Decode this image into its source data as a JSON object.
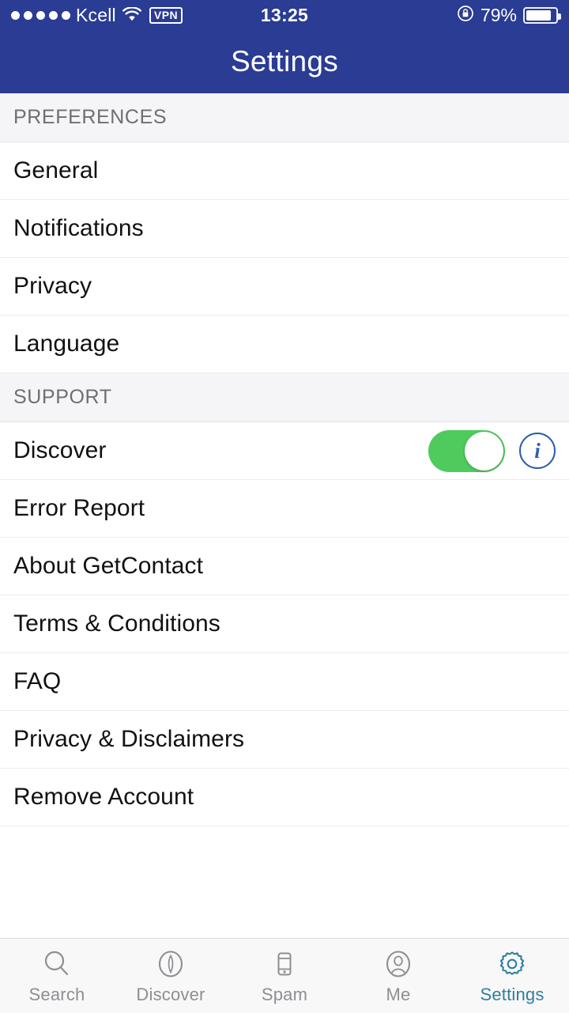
{
  "statusbar": {
    "signal_dots": 5,
    "carrier": "Kcell",
    "wifi_icon": "wifi-icon",
    "vpn_label": "VPN",
    "time": "13:25",
    "lock_icon": "rotation-lock-icon",
    "battery_pct": "79%",
    "battery_icon": "battery-icon"
  },
  "navbar": {
    "title": "Settings"
  },
  "sections": [
    {
      "header": "PREFERENCES",
      "rows": [
        {
          "label": "General",
          "accessory": "none"
        },
        {
          "label": "Notifications",
          "accessory": "none"
        },
        {
          "label": "Privacy",
          "accessory": "none"
        },
        {
          "label": "Language",
          "accessory": "none"
        }
      ]
    },
    {
      "header": "SUPPORT",
      "rows": [
        {
          "label": "Discover",
          "accessory": "toggle-on-and-info",
          "toggle_state": "on",
          "info_glyph": "i"
        },
        {
          "label": "Error Report",
          "accessory": "none"
        },
        {
          "label": "About GetContact",
          "accessory": "none"
        },
        {
          "label": "Terms & Conditions",
          "accessory": "none"
        },
        {
          "label": "FAQ",
          "accessory": "none"
        },
        {
          "label": "Privacy & Disclaimers",
          "accessory": "none"
        },
        {
          "label": "Remove Account",
          "accessory": "none"
        }
      ]
    }
  ],
  "tabbar": {
    "active_index": 4,
    "tabs": [
      {
        "label": "Search",
        "icon": "search-icon"
      },
      {
        "label": "Discover",
        "icon": "compass-icon"
      },
      {
        "label": "Spam",
        "icon": "phone-device-icon"
      },
      {
        "label": "Me",
        "icon": "person-circle-icon"
      },
      {
        "label": "Settings",
        "icon": "gear-icon"
      }
    ]
  },
  "colors": {
    "header_blue": "#2a3c93",
    "toggle_green": "#4ecb5c",
    "info_blue": "#2b5ea8",
    "active_tab": "#2f7e9e",
    "inactive_tab": "#8e8e93",
    "section_bg": "#f5f5f7"
  }
}
